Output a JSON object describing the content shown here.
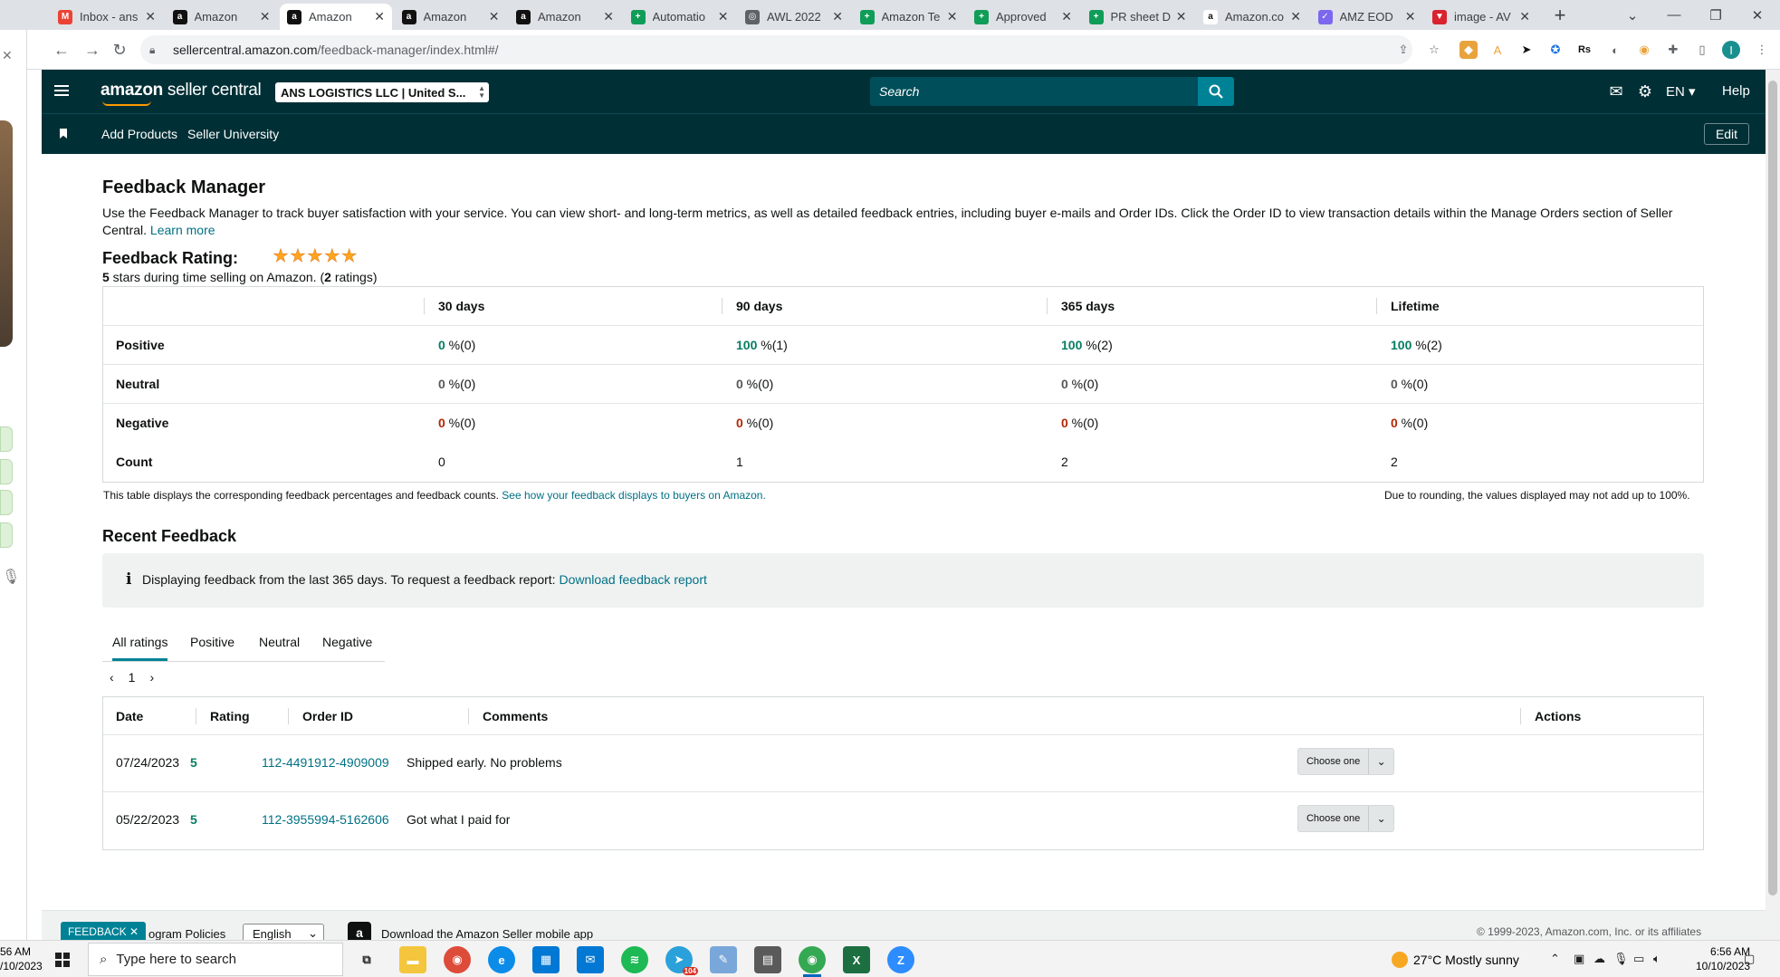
{
  "browser": {
    "tabs": [
      {
        "label": "Inbox - ans",
        "favicon": "gmail-icon",
        "color": "#ea4335",
        "glyph": "M"
      },
      {
        "label": "Amazon",
        "favicon": "amazon-icon",
        "color": "#111111",
        "glyph": "a"
      },
      {
        "label": "Amazon",
        "favicon": "amazon-icon",
        "color": "#111111",
        "glyph": "a",
        "active": true
      },
      {
        "label": "Amazon",
        "favicon": "amazon-icon",
        "color": "#111111",
        "glyph": "a"
      },
      {
        "label": "Amazon",
        "favicon": "amazon-icon",
        "color": "#111111",
        "glyph": "a"
      },
      {
        "label": "Automatio",
        "favicon": "sheets-icon",
        "color": "#0f9d58",
        "glyph": "+"
      },
      {
        "label": "AWL 2022",
        "favicon": "globe-icon",
        "color": "#5f6368",
        "glyph": "◎"
      },
      {
        "label": "Amazon Te",
        "favicon": "sheets-icon",
        "color": "#0f9d58",
        "glyph": "+"
      },
      {
        "label": "Approved",
        "favicon": "sheets-icon",
        "color": "#0f9d58",
        "glyph": "+"
      },
      {
        "label": "PR sheet D",
        "favicon": "sheets-icon",
        "color": "#0f9d58",
        "glyph": "+"
      },
      {
        "label": "Amazon.co",
        "favicon": "amazon-smile-icon",
        "color": "#ffffff",
        "glyph": "a"
      },
      {
        "label": "AMZ EOD",
        "favicon": "clickup-icon",
        "color": "#7b68ee",
        "glyph": "✓"
      },
      {
        "label": "image - AV",
        "favicon": "vivaldi-icon",
        "color": "#d9232e",
        "glyph": "▼"
      }
    ],
    "new_tab": "+",
    "url_host": "sellercentral.amazon.com",
    "url_path": "/feedback-manager/index.html#/",
    "url_tooltip": "sellercentral.amazon.com"
  },
  "header": {
    "logo_brand": "amazon",
    "logo_sub": " seller central",
    "account": "ANS LOGISTICS LLC | United S...",
    "search_placeholder": "Search",
    "language": "EN",
    "help": "Help"
  },
  "subnav": {
    "links": [
      "Add Products",
      "Seller University"
    ],
    "edit": "Edit"
  },
  "page": {
    "title": "Feedback Manager",
    "intro": "Use the Feedback Manager to track buyer satisfaction with your service. You can view short- and long-term metrics, as well as detailed feedback entries, including buyer e-mails and Order IDs. Click the Order ID to view transaction details within the Manage Orders section of Seller Central.",
    "learn_more": "Learn more",
    "rating_label": "Feedback Rating:",
    "stars": 5,
    "rating_stars_num": "5",
    "rating_sub_a": " stars during time selling on Amazon. (",
    "rating_count": "2",
    "rating_sub_b": " ratings)"
  },
  "metrics": {
    "columns": [
      "30 days",
      "90 days",
      "365 days",
      "Lifetime"
    ],
    "rows": [
      {
        "label": "Positive",
        "cells": [
          [
            "0",
            " %(0)",
            "green"
          ],
          [
            "100",
            " %(1)",
            "green"
          ],
          [
            "100",
            " %(2)",
            "green"
          ],
          [
            "100",
            " %(2)",
            "green"
          ]
        ]
      },
      {
        "label": "Neutral",
        "cells": [
          [
            "0",
            " %(0)",
            "gray"
          ],
          [
            "0",
            " %(0)",
            "gray"
          ],
          [
            "0",
            " %(0)",
            "gray"
          ],
          [
            "0",
            " %(0)",
            "gray"
          ]
        ]
      },
      {
        "label": "Negative",
        "cells": [
          [
            "0",
            " %(0)",
            "red"
          ],
          [
            "0",
            " %(0)",
            "red"
          ],
          [
            "0",
            " %(0)",
            "red"
          ],
          [
            "0",
            " %(0)",
            "red"
          ]
        ]
      }
    ],
    "count_label": "Count",
    "counts": [
      "0",
      "1",
      "2",
      "2"
    ],
    "note_left": "This table displays the corresponding feedback percentages and feedback counts.",
    "note_link": "See how your feedback displays to buyers on Amazon.",
    "note_right": "Due to rounding, the values displayed may not add up to 100%."
  },
  "recent": {
    "title": "Recent Feedback",
    "info_icon": "i",
    "info_text": "Displaying feedback from the last 365 days. To request a feedback report:",
    "info_link": "Download feedback report",
    "tabs": [
      "All ratings",
      "Positive",
      "Neutral",
      "Negative"
    ],
    "page": "1",
    "columns": [
      "Date",
      "Rating",
      "Order ID",
      "Comments",
      "Actions"
    ],
    "rows": [
      {
        "date": "07/24/2023",
        "rating": "5",
        "order": "112-4491912-4909009",
        "comment": "Shipped early. No problems",
        "action": "Choose one"
      },
      {
        "date": "05/22/2023",
        "rating": "5",
        "order": "112-3955994-5162606",
        "comment": "Got what I paid for",
        "action": "Choose one"
      }
    ]
  },
  "footer": {
    "feedback_tab": "FEEDBACK",
    "policies": "ogram Policies",
    "language": "English",
    "app_text": "Download the Amazon Seller mobile app",
    "copyright": "© 1999-2023, Amazon.com, Inc. or its affiliates"
  },
  "taskbar": {
    "left_time": "56 AM",
    "left_date": "/10/2023",
    "search_placeholder": "Type here to search",
    "weather": "27°C  Mostly sunny",
    "time": "6:56 AM",
    "date": "10/10/2023",
    "chrome_badge": "104"
  },
  "colors": {
    "header_bg": "#002f36",
    "accent": "#008296",
    "link": "#007185",
    "positive": "#067d62",
    "negative": "#b12704",
    "star": "#ffa41c"
  }
}
